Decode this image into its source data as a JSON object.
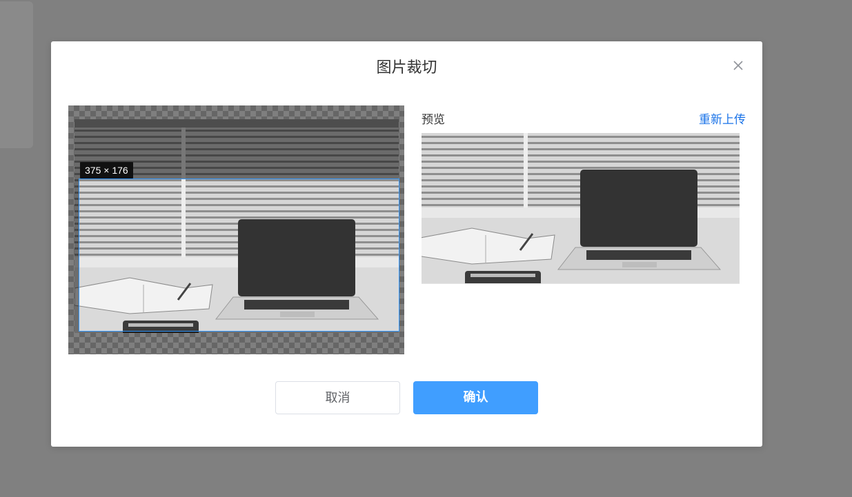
{
  "dialog": {
    "title": "图片裁切",
    "close_icon": "close-icon"
  },
  "cropper": {
    "size_label": "375 × 176"
  },
  "preview": {
    "label": "预览",
    "reupload_label": "重新上传"
  },
  "footer": {
    "cancel_label": "取消",
    "confirm_label": "确认"
  },
  "colors": {
    "accent": "#409eff",
    "link": "#1a73e8",
    "overlay": "#808080"
  }
}
